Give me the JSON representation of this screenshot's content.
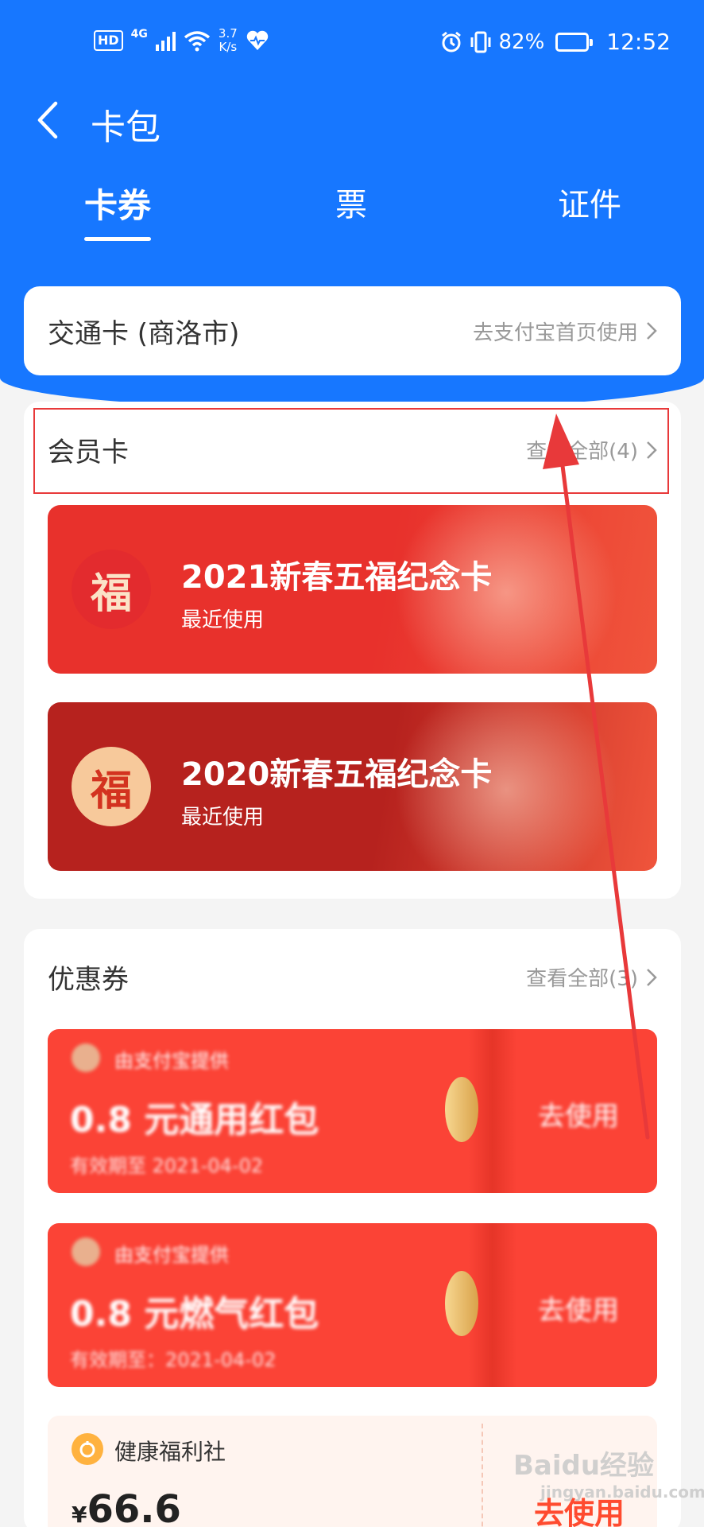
{
  "status_bar": {
    "hd": "HD",
    "network": "4G",
    "speed_value": "3.7",
    "speed_unit": "K/s",
    "battery": "82%",
    "battery_level": 0.82,
    "time": "12:52"
  },
  "nav": {
    "title": "卡包"
  },
  "tabs": [
    {
      "label": "卡券",
      "active": true
    },
    {
      "label": "票",
      "active": false
    },
    {
      "label": "证件",
      "active": false
    }
  ],
  "transit_card": {
    "name": "交通卡 (商洛市)",
    "link": "去支付宝首页使用"
  },
  "membership": {
    "title": "会员卡",
    "view_all": "查看全部(4)",
    "cards": [
      {
        "logo_char": "福",
        "title": "2021新春五福纪念卡",
        "subtitle": "最近使用",
        "bg": "#e8312c",
        "logo_bg": "#e32b2e",
        "logo_fg": "#fbe3c7"
      },
      {
        "logo_char": "福",
        "title": "2020新春五福纪念卡",
        "subtitle": "最近使用",
        "bg": "#b6221e",
        "logo_bg": "#f7c99b",
        "logo_fg": "#d3321f"
      }
    ]
  },
  "coupons": {
    "title": "优惠券",
    "view_all": "查看全部(3)",
    "items": [
      {
        "provider": "由支付宝提供",
        "amount": "0.8 元通用红包",
        "expiry": "有效期至 2021-04-02",
        "action": "去使用"
      },
      {
        "provider": "由支付宝提供",
        "amount": "0.8 元燃气红包",
        "expiry": "有效期至：2021-04-02",
        "action": "去使用"
      }
    ],
    "health": {
      "provider": "健康福利社",
      "currency": "¥",
      "price": "66.6",
      "action": "去使用"
    }
  },
  "watermark": {
    "brand": "Baidu经验",
    "url": "jingyan.baidu.com"
  },
  "colors": {
    "brand_blue": "#1777ff",
    "annotation_red": "#e8393a",
    "coupon_red": "#fb4336"
  }
}
